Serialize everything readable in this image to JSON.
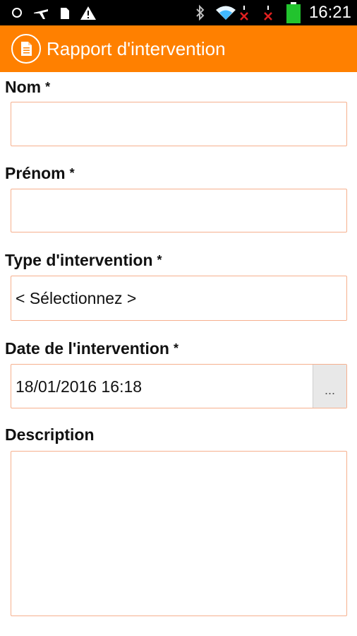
{
  "status_bar": {
    "time": "16:21",
    "icons": [
      "circle-icon",
      "airplane-icon",
      "sim-icon",
      "warning-icon",
      "bluetooth-icon",
      "wifi-icon",
      "signal-x-icon",
      "signal-x-icon",
      "battery-icon"
    ],
    "battery_color": "#22c32e",
    "no_signal_color": "#e02020"
  },
  "app_bar": {
    "title": "Rapport d'intervention",
    "icon": "document-icon",
    "background": "#ff8000"
  },
  "form": {
    "nom": {
      "label": "Nom",
      "required_mark": "*",
      "value": ""
    },
    "prenom": {
      "label": "Prénom",
      "required_mark": "*",
      "value": ""
    },
    "type_intervention": {
      "label": "Type d'intervention",
      "required_mark": "*",
      "value": "< Sélectionnez >"
    },
    "date_intervention": {
      "label": "Date de l'intervention",
      "required_mark": "*",
      "value": "18/01/2016 16:18",
      "picker_label": "..."
    },
    "description": {
      "label": "Description",
      "value": ""
    },
    "field_border_color": "#f6b08e"
  }
}
